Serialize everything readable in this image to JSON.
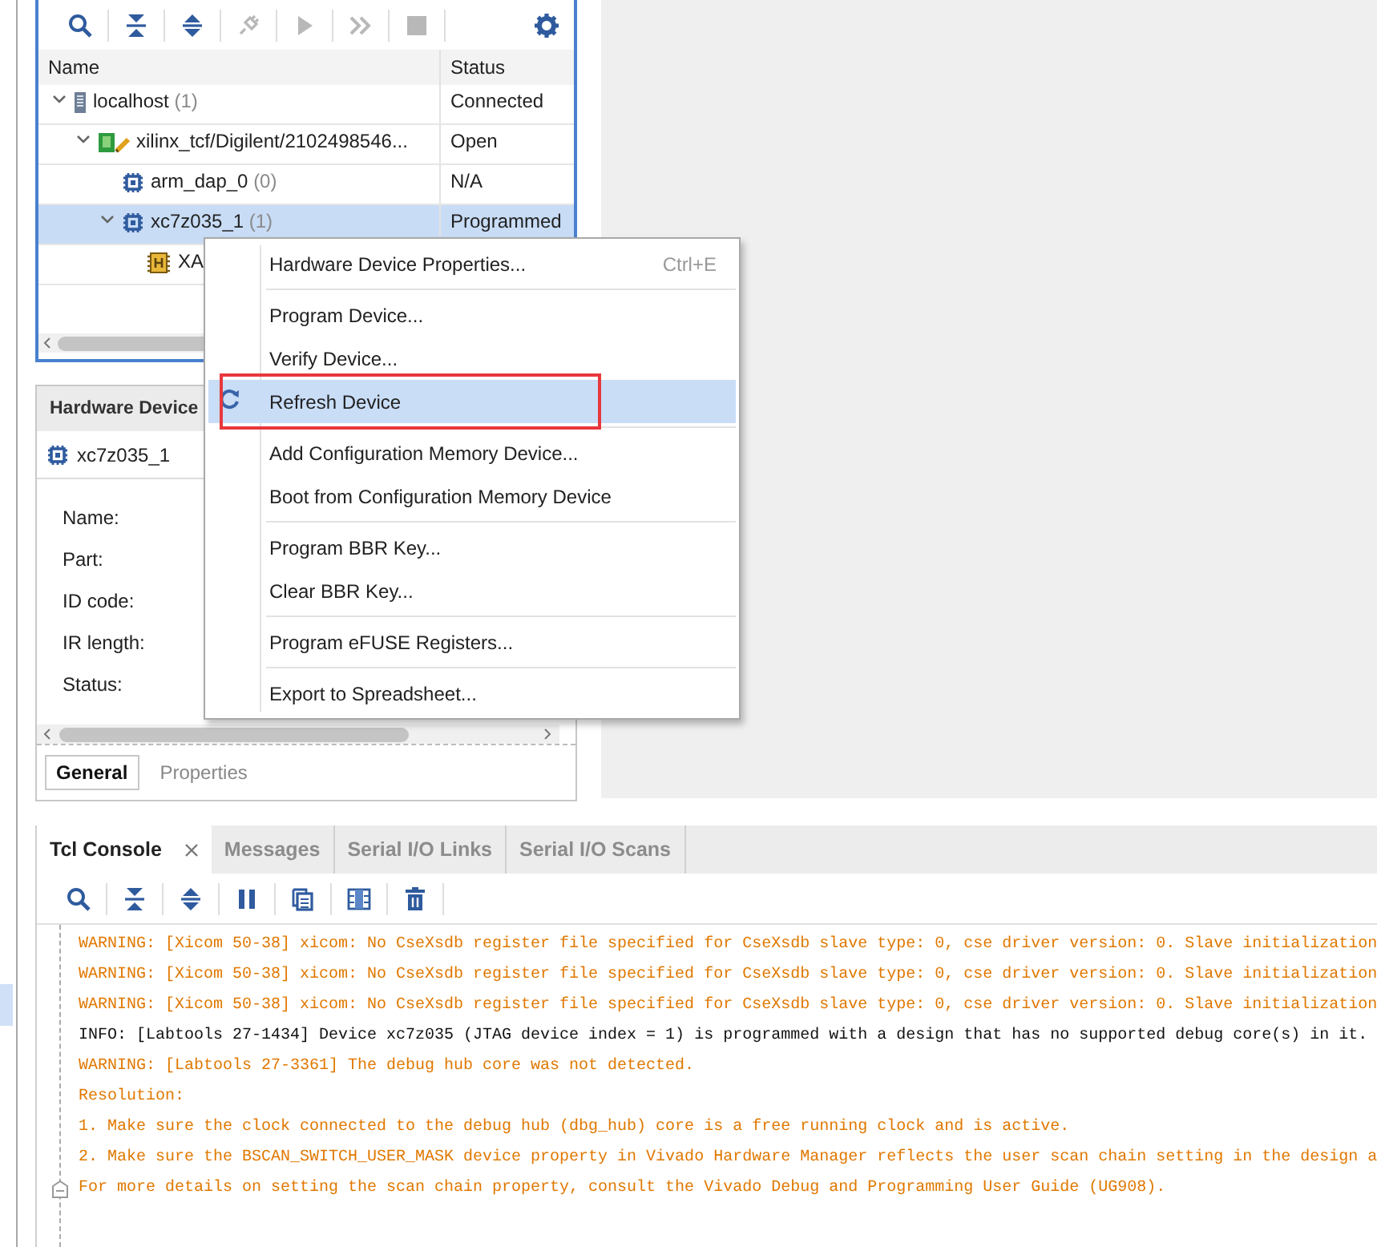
{
  "hardware_panel": {
    "toolbar": [
      {
        "kind": "search",
        "disabled": false
      },
      {
        "kind": "collapse",
        "disabled": false
      },
      {
        "kind": "expand",
        "disabled": false
      },
      {
        "kind": "plug",
        "disabled": true
      },
      {
        "kind": "play",
        "disabled": true
      },
      {
        "kind": "forward",
        "disabled": true
      },
      {
        "kind": "stop",
        "disabled": true
      },
      {
        "kind": "gear",
        "disabled": false
      }
    ],
    "columns": [
      "Name",
      "Status"
    ],
    "tree": [
      {
        "kind": "host",
        "name": "localhost",
        "count": "(1)",
        "status": "Connected",
        "selected": false,
        "expanded": true,
        "children": [
          {
            "kind": "board",
            "name": "xilinx_tcf/Digilent/2102498546...",
            "status": "Open",
            "selected": false,
            "expanded": true,
            "children": [
              {
                "kind": "chip",
                "name": "arm_dap_0",
                "count": "(0)",
                "status": "N/A",
                "selected": false
              },
              {
                "kind": "chip",
                "name": "xc7z035_1",
                "count": "(1)",
                "status": "Programmed",
                "selected": true,
                "expanded": true,
                "children": [
                  {
                    "kind": "core",
                    "name": "XA",
                    "selected": false
                  }
                ]
              }
            ]
          }
        ]
      }
    ]
  },
  "properties_panel": {
    "title": "Hardware Device",
    "device": "xc7z035_1",
    "fields": [
      "Name:",
      "Part:",
      "ID code:",
      "IR length:",
      "Status:"
    ],
    "tabs": [
      {
        "label": "General",
        "selected": true
      },
      {
        "label": "Properties",
        "selected": false
      }
    ]
  },
  "context_menu": {
    "groups": [
      [
        {
          "label": "Hardware Device Properties...",
          "shortcut": "Ctrl+E",
          "kind": "plain",
          "selected": false,
          "outlined": false
        }
      ],
      [
        {
          "label": "Program Device...",
          "kind": "plain",
          "selected": false,
          "outlined": false
        },
        {
          "label": "Verify Device...",
          "kind": "plain",
          "selected": false,
          "outlined": false
        },
        {
          "label": "Refresh Device",
          "kind": "refresh",
          "selected": true,
          "outlined": true
        }
      ],
      [
        {
          "label": "Add Configuration Memory Device...",
          "kind": "plain",
          "selected": false,
          "outlined": false
        },
        {
          "label": "Boot from Configuration Memory Device",
          "kind": "plain",
          "selected": false,
          "outlined": false
        }
      ],
      [
        {
          "label": "Program BBR Key...",
          "kind": "plain",
          "selected": false,
          "outlined": false
        },
        {
          "label": "Clear BBR Key...",
          "kind": "plain",
          "selected": false,
          "outlined": false
        }
      ],
      [
        {
          "label": "Program eFUSE Registers...",
          "kind": "plain",
          "selected": false,
          "outlined": false
        }
      ],
      [
        {
          "label": "Export to Spreadsheet...",
          "kind": "plain",
          "selected": false,
          "outlined": false
        }
      ]
    ]
  },
  "console": {
    "tabs": [
      {
        "label": "Tcl Console",
        "selected": true,
        "closable": true
      },
      {
        "label": "Messages",
        "selected": false,
        "closable": false
      },
      {
        "label": "Serial I/O Links",
        "selected": false,
        "closable": false
      },
      {
        "label": "Serial I/O Scans",
        "selected": false,
        "closable": false
      }
    ],
    "toolbar": [
      {
        "kind": "search"
      },
      {
        "kind": "collapse"
      },
      {
        "kind": "expand"
      },
      {
        "kind": "pause"
      },
      {
        "kind": "copy"
      },
      {
        "kind": "columns"
      },
      {
        "kind": "trash"
      }
    ],
    "lines": [
      {
        "kind": "warning",
        "fold": false,
        "text": "WARNING: [Xicom 50-38] xicom: No CseXsdb register file specified for CseXsdb slave type: 0, cse driver version: 0. Slave initialization"
      },
      {
        "kind": "warning",
        "fold": false,
        "text": "WARNING: [Xicom 50-38] xicom: No CseXsdb register file specified for CseXsdb slave type: 0, cse driver version: 0. Slave initialization"
      },
      {
        "kind": "warning",
        "fold": false,
        "text": "WARNING: [Xicom 50-38] xicom: No CseXsdb register file specified for CseXsdb slave type: 0, cse driver version: 0. Slave initialization"
      },
      {
        "kind": "info",
        "fold": false,
        "text": "INFO: [Labtools 27-1434] Device xc7z035 (JTAG device index = 1) is programmed with a design that has no supported debug core(s) in it."
      },
      {
        "kind": "warning",
        "fold": false,
        "text": "WARNING: [Labtools 27-3361] The debug hub core was not detected."
      },
      {
        "kind": "warning",
        "fold": false,
        "text": "Resolution:"
      },
      {
        "kind": "warning",
        "fold": false,
        "text": "1. Make sure the clock connected to the debug hub (dbg_hub) core is a free running clock and is active."
      },
      {
        "kind": "warning",
        "fold": false,
        "text": "2. Make sure the BSCAN_SWITCH_USER_MASK device property in Vivado Hardware Manager reflects the user scan chain setting in the design a"
      },
      {
        "kind": "warning",
        "fold": true,
        "text": "For more details on setting the scan chain property, consult the Vivado Debug and Programming User Guide (UG908)."
      }
    ]
  }
}
